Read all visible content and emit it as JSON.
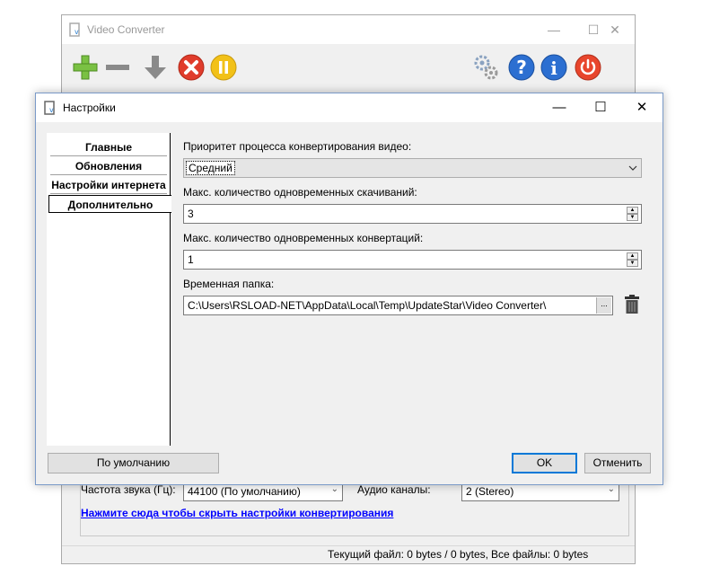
{
  "main_window": {
    "title": "Video Converter",
    "controls": {
      "minimize": "—",
      "maximize": "☐",
      "close": "✕"
    },
    "toolbar": {
      "add_icon": "plus-icon",
      "remove_icon": "minus-icon",
      "download_icon": "down-arrow-icon",
      "cancel_icon": "x-circle-icon",
      "pause_icon": "pause-circle-icon",
      "settings_icon": "gears-icon",
      "help_icon": "question-icon",
      "info_icon": "info-icon",
      "power_icon": "power-icon"
    },
    "audio": {
      "freq_label": "Частота звука (Гц):",
      "freq_value": "44100 (По умолчанию)",
      "channels_label": "Аудио каналы:",
      "channels_value": "2 (Stereo)"
    },
    "hide_settings_link": "Нажмите сюда чтобы скрыть настройки конвертирования",
    "status": {
      "current_file": "Текущий файл: 0 bytes / 0 bytes,",
      "all_files": "Все файлы: 0 bytes"
    }
  },
  "dialog": {
    "title": "Настройки",
    "controls": {
      "minimize": "—",
      "maximize": "☐",
      "close": "✕"
    },
    "tabs": [
      {
        "label": "Главные"
      },
      {
        "label": "Обновления"
      },
      {
        "label": "Настройки интернета"
      },
      {
        "label": "Дополнительно"
      }
    ],
    "priority_label": "Приоритет процесса конвертирования видео:",
    "priority_value": "Средний",
    "max_downloads_label": "Макс. количество одновременных скачиваний:",
    "max_downloads_value": "3",
    "max_conversions_label": "Макс. количество одновременных конвертаций:",
    "max_conversions_value": "1",
    "temp_folder_label": "Временная папка:",
    "temp_folder_value": "C:\\Users\\RSLOAD-NET\\AppData\\Local\\Temp\\UpdateStar\\Video Converter\\",
    "browse_label": "...",
    "defaults_button": "По умолчанию",
    "ok_button": "OK",
    "cancel_button": "Отменить"
  },
  "colors": {
    "accent": "#0078d7",
    "link": "#0000ff",
    "add_green": "#7ac143",
    "cancel_red": "#e03c2c",
    "pause_yellow": "#f2c118",
    "help_blue": "#2c6fd1",
    "power_red": "#e8452c"
  }
}
